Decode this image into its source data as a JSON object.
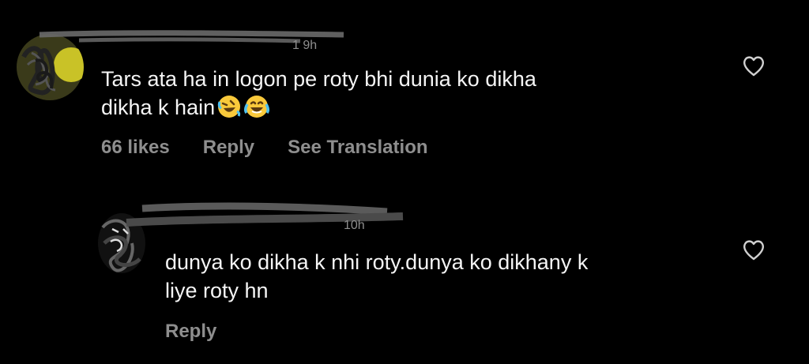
{
  "comments": [
    {
      "text_line1": "Tars ata ha in logon pe roty bhi dunia ko dikha",
      "text_line2": "dikha k hain",
      "emojis": [
        "rolling-on-floor-laughing",
        "face-with-tears-of-joy"
      ],
      "likes": "66 likes",
      "reply_label": "Reply",
      "translate_label": "See Translation",
      "username_redacted": true
    },
    {
      "text_line1": "dunya ko dikha k nhi roty.dunya ko dikhany k",
      "text_line2": "liye roty hn",
      "reply_label": "Reply",
      "username_redacted": true
    }
  ],
  "colors": {
    "background": "#000000",
    "text": "#f5f5f5",
    "muted": "#8e8e8e"
  }
}
